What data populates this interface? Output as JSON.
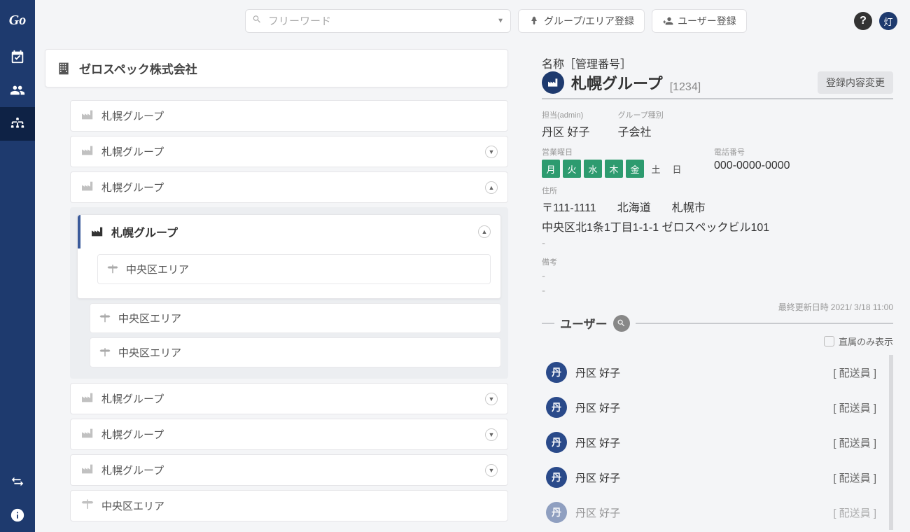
{
  "logo": "Go",
  "brand_char": "灯",
  "search": {
    "placeholder": "フリーワード"
  },
  "top_buttons": {
    "group_area": "グループ/エリア登録",
    "user": "ユーザー登録"
  },
  "company": {
    "name": "ゼロスペック株式会社"
  },
  "tree": {
    "g1": "札幌グループ",
    "g2": "札幌グループ",
    "g3": "札幌グループ",
    "g3_child": "札幌グループ",
    "g3_area1": "中央区エリア",
    "g3_area2": "中央区エリア",
    "g3_area3": "中央区エリア",
    "g4": "札幌グループ",
    "g5": "札幌グループ",
    "g6": "札幌グループ",
    "a1": "中央区エリア"
  },
  "detail": {
    "name_label": "名称［管理番号］",
    "name": "札幌グループ",
    "code": "[1234]",
    "edit_btn": "登録内容変更",
    "admin_label": "担当(admin)",
    "admin": "丹区 好子",
    "type_label": "グループ種別",
    "type": "子会社",
    "days_label": "営業曜日",
    "days": [
      "月",
      "火",
      "水",
      "木",
      "金",
      "土",
      "日"
    ],
    "days_on": [
      true,
      true,
      true,
      true,
      true,
      false,
      false
    ],
    "phone_label": "電話番号",
    "phone": "000-0000-0000",
    "addr_label": "住所",
    "addr_zip": "〒111-1111",
    "addr_pref": "北海道",
    "addr_city": "札幌市",
    "addr_full": "中央区北1条1丁目1-1-1 ゼロスペックビル101",
    "memo_label": "備考",
    "updated_label": "最終更新日時",
    "updated": "2021/ 3/18 11:00"
  },
  "users": {
    "section_title": "ユーザー",
    "direct_only": "直属のみ表示",
    "avatar_char": "丹",
    "list": [
      {
        "name": "丹区 好子",
        "role": "[ 配送員 ]"
      },
      {
        "name": "丹区 好子",
        "role": "[ 配送員 ]"
      },
      {
        "name": "丹区 好子",
        "role": "[ 配送員 ]"
      },
      {
        "name": "丹区 好子",
        "role": "[ 配送員 ]"
      },
      {
        "name": "丹区 好子",
        "role": "[ 配送員 ]"
      }
    ]
  }
}
